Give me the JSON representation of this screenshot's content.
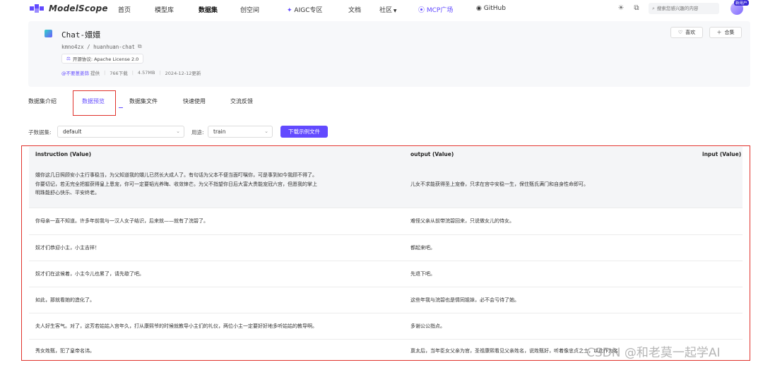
{
  "nav": {
    "logo_text": "ModelScope",
    "items": [
      "首页",
      "模型库",
      "数据集",
      "创空间",
      "AIGC专区",
      "文档",
      "社区",
      "MCP广场",
      "GitHub"
    ],
    "search_placeholder": "搜索您感兴趣的内容",
    "avatar_badge": "新用户",
    "accent_color": "#624aff"
  },
  "dataset": {
    "title": "Chat-嬛嬛",
    "path": "kmno4zx / huanhuan-chat",
    "license": "开源协议: Apache License 2.0",
    "author": "@不要葱姜蒜",
    "provided": "提供",
    "downloads": "766下载",
    "size": "4.57MB",
    "updated": "2024-12-12更新",
    "like_label": "喜欢",
    "collect_label": "合集"
  },
  "tabs": [
    "数据集介绍",
    "数据预览",
    "数据集文件",
    "快速使用",
    "交流反馈"
  ],
  "filters": {
    "subset_label": "子数据集:",
    "subset_value": "default",
    "split_label": "用途:",
    "split_value": "train",
    "download_label": "下载示例文件"
  },
  "table": {
    "columns": [
      "instruction (Value)",
      "output (Value)",
      "input (Value)"
    ],
    "rows": [
      {
        "instruction": [
          "嬛你这几日照顾安小主行事稳当，为父知道我的嬛儿已然长大成人了。有句话为父本不便当面叮嘱你，可是事到如今我顾不得了。",
          "你要切记，若无完全把握获得皇上恩宠，你可一定要韬光养晦、收敛锋芒。为父不指望你日后大富大贵能宠冠六宫，但愿我的掌上",
          "明珠能舒心快乐、平安终老。"
        ],
        "output": "儿女不求能获得圣上宠眷，只求在宫中安稳一生，保住甄氏满门和自身性命即可。"
      },
      {
        "instruction": [
          "你母亲一直不知道。许多年前我与一汉人女子结识，后来就——就有了浣碧了。"
        ],
        "output": "难怪父亲从前带浣碧回来，只说做女儿的侍女。"
      },
      {
        "instruction": [
          "奴才们恭迎小主，小主吉祥！"
        ],
        "output": "都起来吧。"
      },
      {
        "instruction": [
          "奴才们在这候着，小主今儿也累了，请先歇了吧。"
        ],
        "output": "先退下吧。"
      },
      {
        "instruction": [
          "如此，那就看她的造化了。"
        ],
        "output": "这些年我与浣碧也是情同姐妹，必不会亏待了她。"
      },
      {
        "instruction": [
          "夫人好生客气。对了，这芳若姑姑入宫年久，打从康熙爷的时候就教导小主们的礼仪，两位小主一定要好好地多听姑姑的教导啊。"
        ],
        "output": "多谢公公指点。"
      },
      {
        "instruction": [
          "秀女姓甄，犯了皇帝名讳。"
        ],
        "output": "禀太后，当年臣女父亲为官，圣祖康熙看见父亲姓名，说姓甄好，听着像忠贞之士，以此作为名"
      }
    ]
  },
  "watermark": "CSDN @和老莫一起学AI"
}
